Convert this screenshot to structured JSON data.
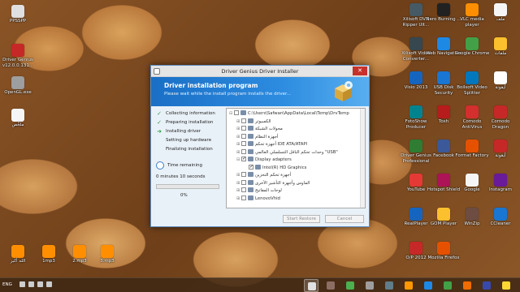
{
  "desktop_icons_left": [
    {
      "label": "PPSSPP",
      "color": "#e0e0e0"
    },
    {
      "label": "Driver Genius v12.0.0.131...",
      "color": "#c62828"
    },
    {
      "label": "OpenGL.exe",
      "color": "#9e9e9e"
    },
    {
      "label": "ملخّص",
      "color": "#f5f5f5"
    },
    {
      "label": "1mp3",
      "color": "#ff8f00"
    },
    {
      "label": "2.mp3",
      "color": "#ff8f00"
    },
    {
      "label": "3.mp3",
      "color": "#ff8f00"
    },
    {
      "label": "الله أكبر",
      "color": "#ff8f00"
    }
  ],
  "desktop_icons_right": [
    {
      "label": "Xilisoft DVD Ripper Ult...",
      "color": "#455a64"
    },
    {
      "label": "Nero Burning ...",
      "color": "#212121"
    },
    {
      "label": "VLC media player",
      "color": "#ff8f00"
    },
    {
      "label": "ملف",
      "color": "#f5f5f5"
    },
    {
      "label": "Xilisoft Video Converter...",
      "color": "#37474f"
    },
    {
      "label": "Web Navigation",
      "color": "#1e88e5"
    },
    {
      "label": "Google Chrome",
      "color": "#43a047"
    },
    {
      "label": "ملفات",
      "color": "#fbc02d"
    },
    {
      "label": "Visio 2013",
      "color": "#1565c0"
    },
    {
      "label": "USB Disk Security",
      "color": "#1976d2"
    },
    {
      "label": "Boilsoft Video Splitter",
      "color": "#0277bd"
    },
    {
      "label": "أيقونة",
      "color": "#ffffff"
    },
    {
      "label": "FotoShow Producer",
      "color": "#00838f"
    },
    {
      "label": "Tosh",
      "color": "#b71c1c"
    },
    {
      "label": "Comodo AntiVirus",
      "color": "#d32f2f"
    },
    {
      "label": "Comodo Dragon",
      "color": "#c62828"
    },
    {
      "label": "Driver Genius Professional",
      "color": "#2e7d32"
    },
    {
      "label": "Facebook",
      "color": "#3b5998"
    },
    {
      "label": "Format Factory",
      "color": "#e65100"
    },
    {
      "label": "أيقونة",
      "color": "#c62828"
    },
    {
      "label": "YouTube",
      "color": "#e53935"
    },
    {
      "label": "Hotspot Shield",
      "color": "#ad1457"
    },
    {
      "label": "Google",
      "color": "#f5f5f5"
    },
    {
      "label": "Instagram",
      "color": "#6a1b9a"
    },
    {
      "label": "RealPlayer",
      "color": "#1565c0"
    },
    {
      "label": "GOM Player",
      "color": "#fbc02d"
    },
    {
      "label": "WinZip",
      "color": "#6d4c41"
    },
    {
      "label": "CCleaner",
      "color": "#1976d2"
    },
    {
      "label": "O/P 2012",
      "color": "#c62828"
    },
    {
      "label": "Mozilla Firefox",
      "color": "#e65100"
    }
  ],
  "window": {
    "title": "Driver Genius Driver Installer",
    "close_label": "✕",
    "banner_title": "Driver installation program",
    "banner_subtitle": "Please wait while the install program installs the driver...",
    "steps": [
      {
        "label": "Collecting information",
        "state": "done"
      },
      {
        "label": "Preparing installation",
        "state": "done"
      },
      {
        "label": "Installing driver",
        "state": "current"
      },
      {
        "label": "Setting up hardware",
        "state": "pending"
      },
      {
        "label": "Finalizing installation",
        "state": "pending"
      }
    ],
    "time_label": "Time remaining",
    "time_value": "0 minutes 10 seconds",
    "progress_percent": 0,
    "progress_text": "0%",
    "tree": [
      {
        "indent": 0,
        "expander": "⊟",
        "checked": false,
        "label": "C:\\Users\\Safwan\\AppData\\Local\\Temp\\DrvTemp"
      },
      {
        "indent": 1,
        "expander": "⊞",
        "checked": false,
        "label": "الكمبيوتر"
      },
      {
        "indent": 1,
        "expander": "⊞",
        "checked": false,
        "label": "محولات الشبكة"
      },
      {
        "indent": 1,
        "expander": "⊞",
        "checked": false,
        "label": "أجهزة النظام"
      },
      {
        "indent": 1,
        "expander": "⊞",
        "checked": false,
        "label": "أجهزة تحكم IDE ATA/ATAPI"
      },
      {
        "indent": 1,
        "expander": "⊞",
        "checked": false,
        "label": "وحدات تحكم الناقل التسلسلي العالمي \"USB\""
      },
      {
        "indent": 1,
        "expander": "⊟",
        "checked": true,
        "label": "Display adapters"
      },
      {
        "indent": 2,
        "expander": "",
        "checked": true,
        "label": "Intel(R) HD Graphics"
      },
      {
        "indent": 1,
        "expander": "⊞",
        "checked": false,
        "label": "أجهزة تحكم التخزين"
      },
      {
        "indent": 1,
        "expander": "⊞",
        "checked": false,
        "label": "الماوس وأجهزة التأشير الأخرى"
      },
      {
        "indent": 1,
        "expander": "⊞",
        "checked": false,
        "label": "لوحات المفاتيح"
      },
      {
        "indent": 1,
        "expander": "⊞",
        "checked": false,
        "label": "LenovoVhid"
      }
    ],
    "start_restore_label": "Start Restore",
    "cancel_label": "Cancel"
  },
  "taskbar": {
    "language": "ENG",
    "apps": [
      {
        "name": "driver-genius",
        "color": "#e0e0e0",
        "active": true
      },
      {
        "name": "app",
        "color": "#8d6e63",
        "active": false
      },
      {
        "name": "app",
        "color": "#4caf50",
        "active": false
      },
      {
        "name": "app",
        "color": "#9e9e9e",
        "active": false
      },
      {
        "name": "app",
        "color": "#607d8b",
        "active": false
      },
      {
        "name": "app",
        "color": "#ff9800",
        "active": false
      },
      {
        "name": "app",
        "color": "#1e88e5",
        "active": false
      },
      {
        "name": "app",
        "color": "#43a047",
        "active": false
      },
      {
        "name": "app",
        "color": "#ef6c00",
        "active": false
      },
      {
        "name": "app",
        "color": "#3949ab",
        "active": false
      },
      {
        "name": "app",
        "color": "#fdd835",
        "active": false
      }
    ]
  }
}
